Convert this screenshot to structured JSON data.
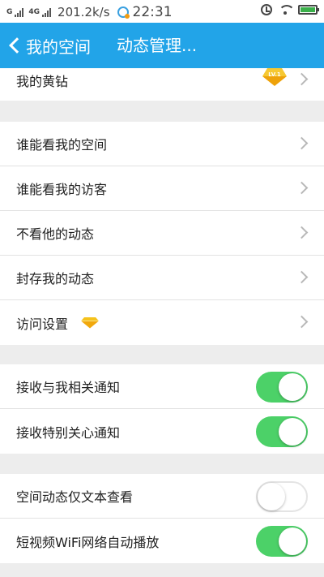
{
  "status_bar": {
    "network_1": "G",
    "network_2": "4G",
    "speed": "201.2k/s",
    "time": "22:31"
  },
  "nav": {
    "back_label": "我的空间",
    "title": "动态管理..."
  },
  "vip": {
    "label": "我的黄钻",
    "badge_text": "LV.1"
  },
  "privacy": [
    {
      "label": "谁能看我的空间"
    },
    {
      "label": "谁能看我的访客"
    },
    {
      "label": "不看他的动态"
    },
    {
      "label": "封存我的动态"
    },
    {
      "label": "访问设置"
    }
  ],
  "notifications": [
    {
      "label": "接收与我相关通知",
      "on": true
    },
    {
      "label": "接收特别关心通知",
      "on": true
    }
  ],
  "display": [
    {
      "label": "空间动态仅文本查看",
      "on": false
    },
    {
      "label": "短视频WiFi网络自动播放",
      "on": true
    }
  ],
  "colors": {
    "nav_blue": "#22a4e8",
    "toggle_on": "#4cd168",
    "background": "#ededed",
    "gem_gold": "#f5c21b"
  }
}
